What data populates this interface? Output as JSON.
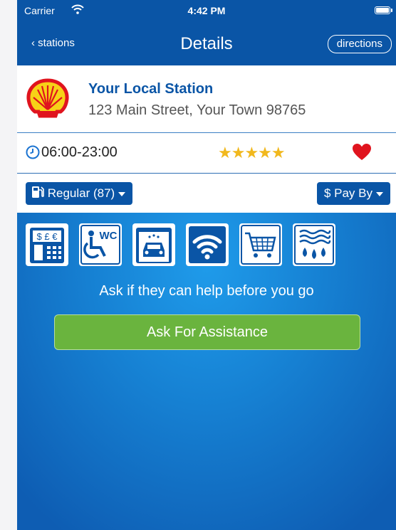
{
  "status_bar": {
    "carrier": "Carrier",
    "time": "4:42 PM",
    "wifi_icon": "wifi-icon",
    "battery_icon": "battery-icon"
  },
  "nav": {
    "back_label": "stations",
    "title": "Details",
    "directions_label": "directions"
  },
  "station": {
    "name": "Your Local Station",
    "address": "123 Main Street, Your Town 98765",
    "logo_icon": "shell-logo"
  },
  "hours": {
    "text": "06:00-23:00",
    "stars": "★★★★★",
    "rating": 5,
    "favorite": true
  },
  "selectors": {
    "fuel_label": "Regular (87)",
    "pay_label": "$ Pay By"
  },
  "amenities": [
    {
      "icon": "atm-icon",
      "label": "$ £ €"
    },
    {
      "icon": "accessible-wc-icon",
      "label": "WC"
    },
    {
      "icon": "car-wash-icon"
    },
    {
      "icon": "wifi-icon"
    },
    {
      "icon": "shopping-cart-icon"
    },
    {
      "icon": "water-icon"
    }
  ],
  "tagline": "Ask if they can help before you go",
  "assist_button": "Ask For Assistance",
  "colors": {
    "primary": "#0a55a6",
    "accent_green": "#6ab43e",
    "star": "#f1b81d",
    "heart": "#e0141e",
    "background_blue": "#1680d2"
  }
}
